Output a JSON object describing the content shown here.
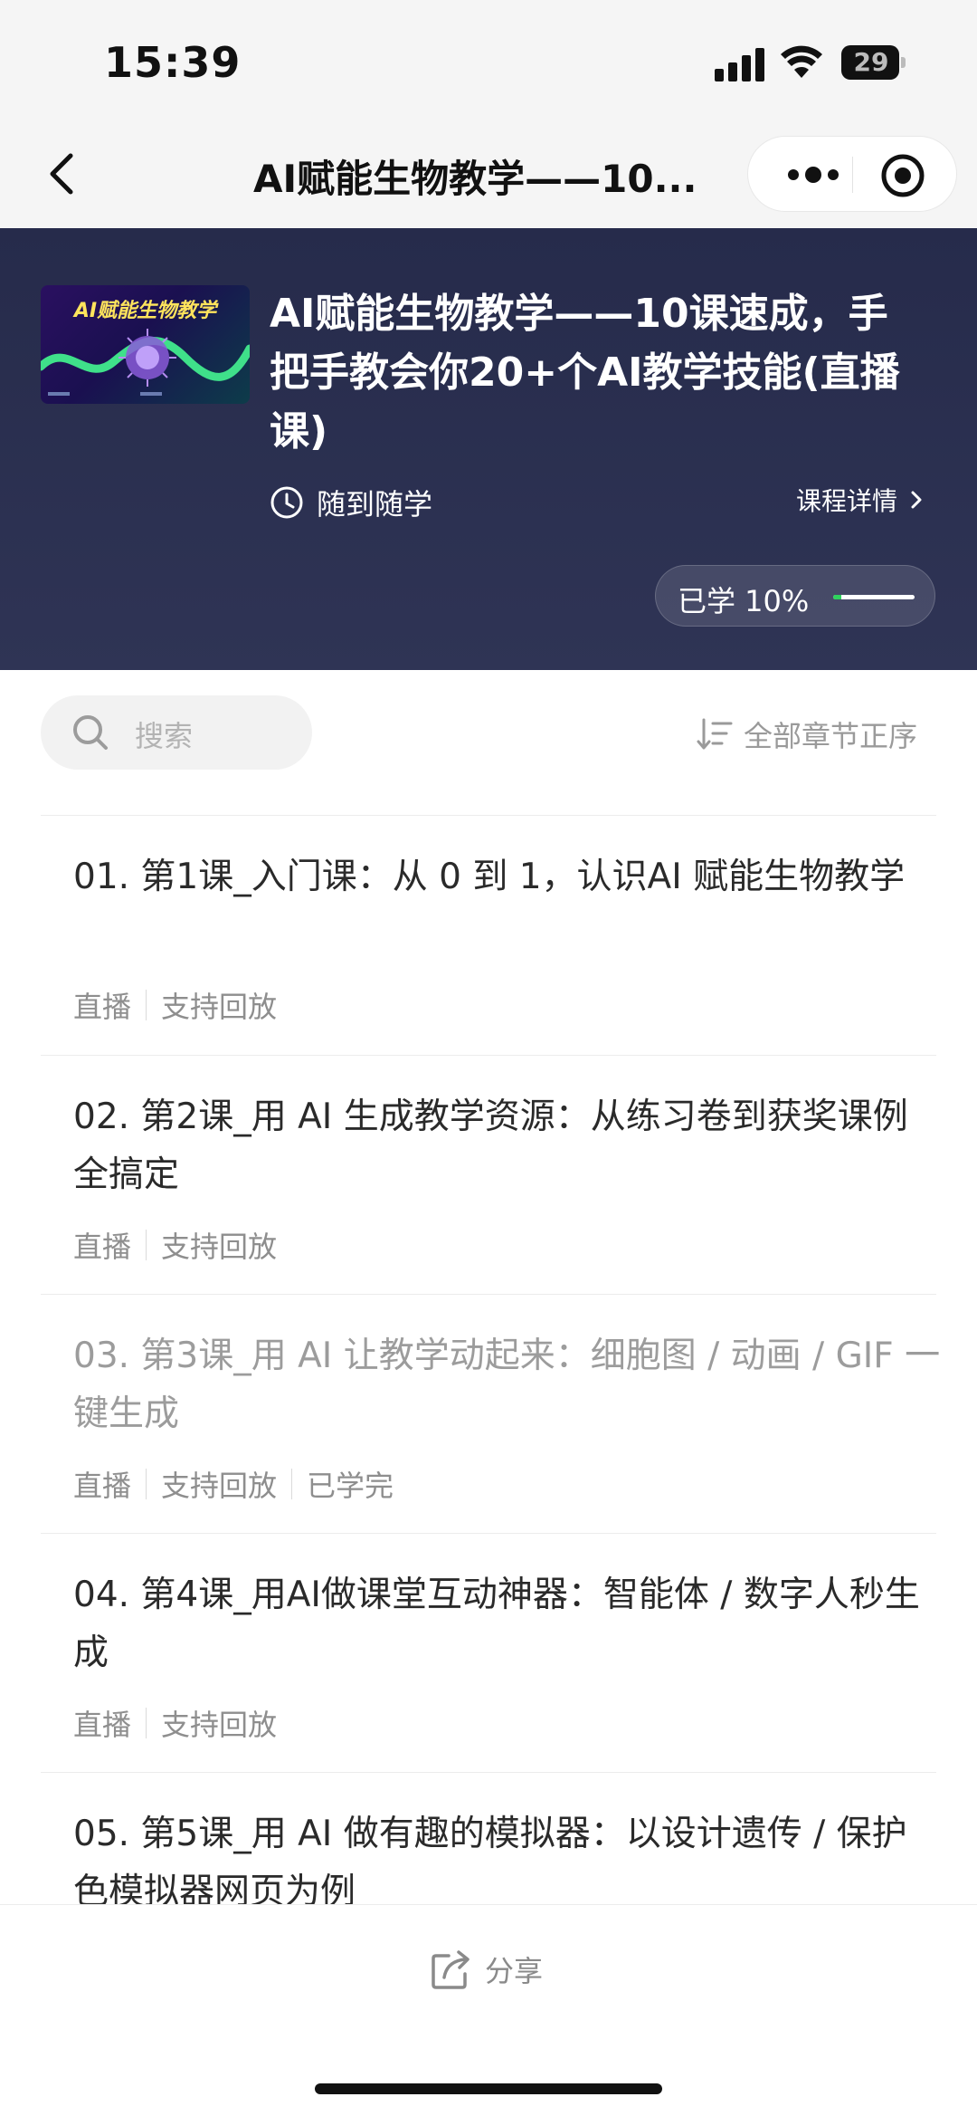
{
  "status_bar": {
    "time": "15:39",
    "battery": "29"
  },
  "nav": {
    "title": "AI赋能生物教学——10..."
  },
  "course": {
    "cover_title": "AI赋能生物教学",
    "title": "AI赋能生物教学——10课速成，手把手教会你20+个AI教学技能(直播课)",
    "study_mode": "随到随学",
    "details_label": "课程详情",
    "progress_label": "已学 10%",
    "progress_fraction": 0.1,
    "progress_color": "#2ed35c"
  },
  "search": {
    "placeholder": "搜索"
  },
  "sort": {
    "label": "全部章节正序"
  },
  "lessons": [
    {
      "title": "01. 第1课_入门课：从 0 到 1，认识AI 赋能生物教学",
      "tags": [
        "直播",
        "支持回放"
      ],
      "completed": false
    },
    {
      "title": "02. 第2课_用 AI 生成教学资源：从练习卷到获奖课例全搞定",
      "tags": [
        "直播",
        "支持回放"
      ],
      "completed": false
    },
    {
      "title": "03. 第3课_用 AI 让教学动起来：细胞图 / 动画 / GIF 一键生成",
      "tags": [
        "直播",
        "支持回放",
        "已学完"
      ],
      "completed": true
    },
    {
      "title": "04. 第4课_用AI做课堂互动神器：智能体 / 数字人秒生成",
      "tags": [
        "直播",
        "支持回放"
      ],
      "completed": false
    },
    {
      "title": "05. 第5课_用 AI 做有趣的模拟器：以设计遗传 / 保护色模拟器网页为例",
      "tags": [],
      "completed": false
    }
  ],
  "bottom": {
    "share_label": "分享"
  }
}
